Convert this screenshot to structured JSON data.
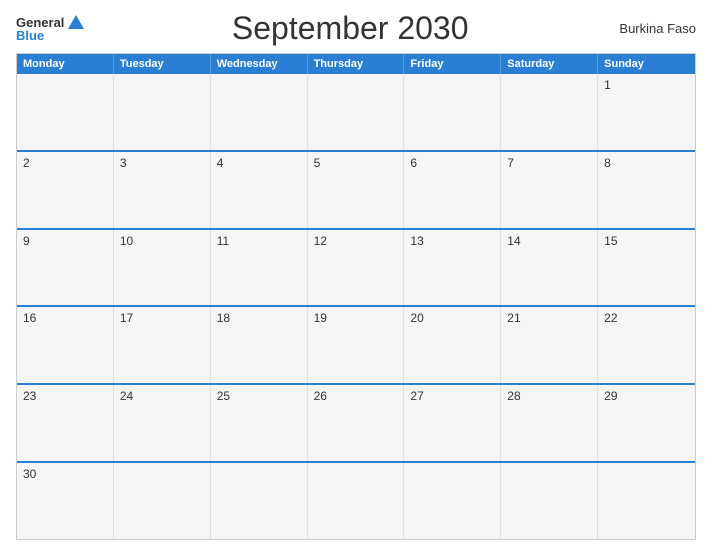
{
  "header": {
    "logo_general": "General",
    "logo_blue": "Blue",
    "title": "September 2030",
    "country": "Burkina Faso"
  },
  "calendar": {
    "days": [
      "Monday",
      "Tuesday",
      "Wednesday",
      "Thursday",
      "Friday",
      "Saturday",
      "Sunday"
    ],
    "rows": [
      [
        {
          "day": "",
          "empty": true
        },
        {
          "day": "",
          "empty": true
        },
        {
          "day": "",
          "empty": true
        },
        {
          "day": "",
          "empty": true
        },
        {
          "day": "",
          "empty": true
        },
        {
          "day": "",
          "empty": true
        },
        {
          "day": "1",
          "empty": false
        }
      ],
      [
        {
          "day": "2",
          "empty": false
        },
        {
          "day": "3",
          "empty": false
        },
        {
          "day": "4",
          "empty": false
        },
        {
          "day": "5",
          "empty": false
        },
        {
          "day": "6",
          "empty": false
        },
        {
          "day": "7",
          "empty": false
        },
        {
          "day": "8",
          "empty": false
        }
      ],
      [
        {
          "day": "9",
          "empty": false
        },
        {
          "day": "10",
          "empty": false
        },
        {
          "day": "11",
          "empty": false
        },
        {
          "day": "12",
          "empty": false
        },
        {
          "day": "13",
          "empty": false
        },
        {
          "day": "14",
          "empty": false
        },
        {
          "day": "15",
          "empty": false
        }
      ],
      [
        {
          "day": "16",
          "empty": false
        },
        {
          "day": "17",
          "empty": false
        },
        {
          "day": "18",
          "empty": false
        },
        {
          "day": "19",
          "empty": false
        },
        {
          "day": "20",
          "empty": false
        },
        {
          "day": "21",
          "empty": false
        },
        {
          "day": "22",
          "empty": false
        }
      ],
      [
        {
          "day": "23",
          "empty": false
        },
        {
          "day": "24",
          "empty": false
        },
        {
          "day": "25",
          "empty": false
        },
        {
          "day": "26",
          "empty": false
        },
        {
          "day": "27",
          "empty": false
        },
        {
          "day": "28",
          "empty": false
        },
        {
          "day": "29",
          "empty": false
        }
      ],
      [
        {
          "day": "30",
          "empty": false
        },
        {
          "day": "",
          "empty": true
        },
        {
          "day": "",
          "empty": true
        },
        {
          "day": "",
          "empty": true
        },
        {
          "day": "",
          "empty": true
        },
        {
          "day": "",
          "empty": true
        },
        {
          "day": "",
          "empty": true
        }
      ]
    ]
  }
}
